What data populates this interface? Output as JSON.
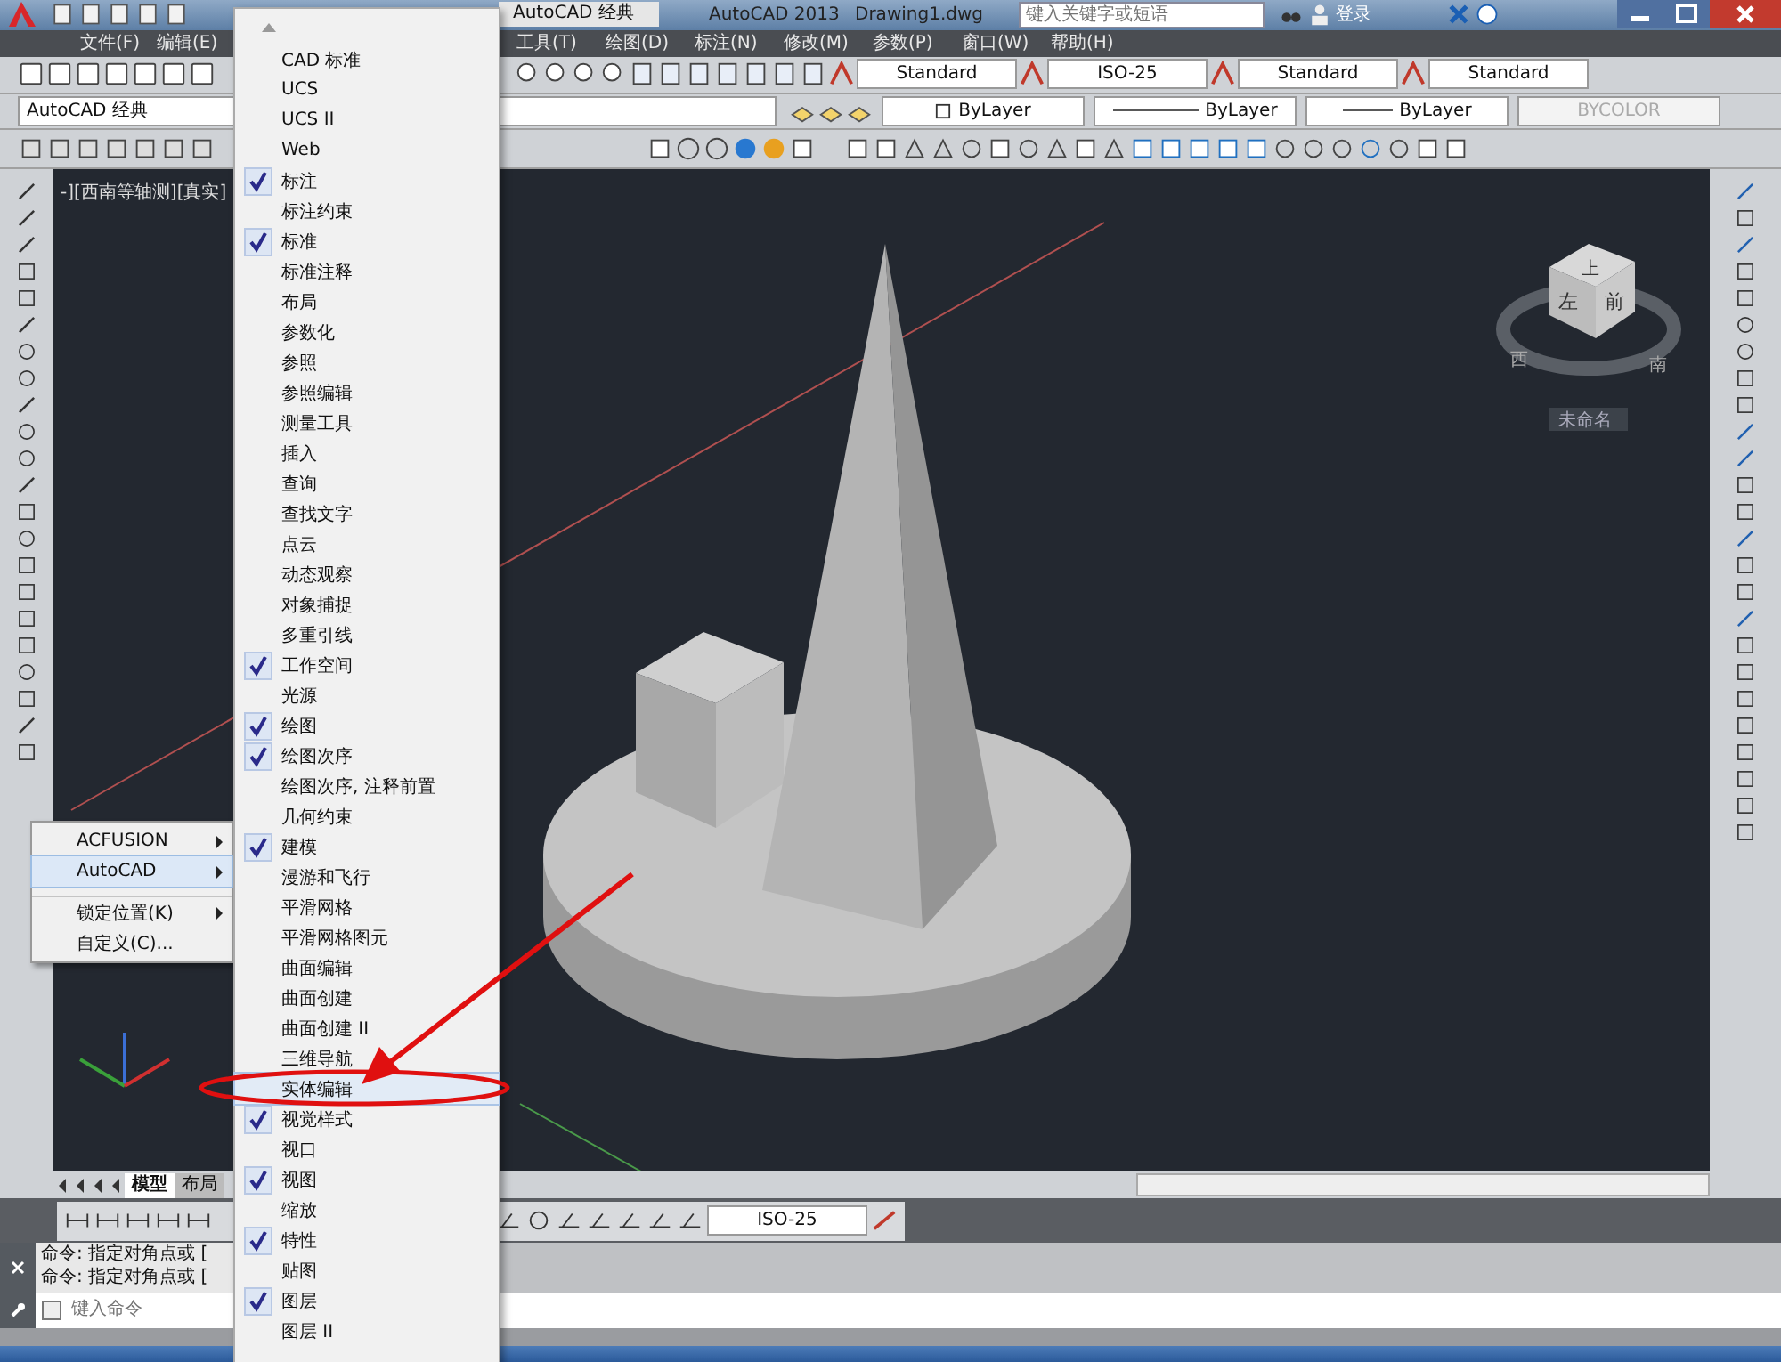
{
  "title_bar": {
    "workspace": "AutoCAD 经典",
    "app_title": "AutoCAD 2013",
    "file_name": "Drawing1.dwg",
    "search": {
      "placeholder": "键入关键字或短语"
    },
    "sign_in": "登录"
  },
  "menu_bar": [
    "文件(F)",
    "编辑(E)",
    "工具(T)",
    "绘图(D)",
    "标注(N)",
    "修改(M)",
    "参数(P)",
    "窗口(W)",
    "帮助(H)"
  ],
  "styles_toolbar": [
    "Standard",
    "ISO-25",
    "Standard",
    "Standard"
  ],
  "workspace_dropdown": "AutoCAD 经典",
  "properties_toolbar": [
    {
      "value": "ByLayer",
      "kind": "color",
      "disabled": false
    },
    {
      "value": "ByLayer",
      "kind": "linetype",
      "disabled": false
    },
    {
      "value": "ByLayer",
      "kind": "lineweight",
      "disabled": false
    },
    {
      "value": "BYCOLOR",
      "kind": "plain",
      "disabled": true
    }
  ],
  "viewport": {
    "label": "-][西南等轴测][真实]",
    "viewcube": {
      "top": "上",
      "left": "左",
      "front": "前",
      "west": "西",
      "south": "南",
      "label": "未命名"
    }
  },
  "layout_tabs": [
    {
      "label": "模型",
      "selected": true
    },
    {
      "label": "布局",
      "selected": false
    }
  ],
  "dim_style": "ISO-25",
  "command_history": [
    "命令: 指定对角点或 [",
    "命令: 指定对角点或 ["
  ],
  "command_input": {
    "placeholder": "键入命令"
  },
  "context_menu": [
    {
      "label": "ACFUSION",
      "submenu": true,
      "selected": false,
      "separator_before": false
    },
    {
      "label": "AutoCAD",
      "submenu": true,
      "selected": true,
      "separator_before": false
    },
    {
      "label": "锁定位置(K)",
      "submenu": true,
      "selected": false,
      "separator_before": true
    },
    {
      "label": "自定义(C)...",
      "submenu": false,
      "selected": false,
      "separator_before": false
    }
  ],
  "toolbar_menu": [
    {
      "label": "CAD 标准",
      "checked": false,
      "selected": false
    },
    {
      "label": "UCS",
      "checked": false,
      "selected": false
    },
    {
      "label": "UCS II",
      "checked": false,
      "selected": false
    },
    {
      "label": "Web",
      "checked": false,
      "selected": false
    },
    {
      "label": "标注",
      "checked": true,
      "selected": false
    },
    {
      "label": "标注约束",
      "checked": false,
      "selected": false
    },
    {
      "label": "标准",
      "checked": true,
      "selected": false
    },
    {
      "label": "标准注释",
      "checked": false,
      "selected": false
    },
    {
      "label": "布局",
      "checked": false,
      "selected": false
    },
    {
      "label": "参数化",
      "checked": false,
      "selected": false
    },
    {
      "label": "参照",
      "checked": false,
      "selected": false
    },
    {
      "label": "参照编辑",
      "checked": false,
      "selected": false
    },
    {
      "label": "测量工具",
      "checked": false,
      "selected": false
    },
    {
      "label": "插入",
      "checked": false,
      "selected": false
    },
    {
      "label": "查询",
      "checked": false,
      "selected": false
    },
    {
      "label": "查找文字",
      "checked": false,
      "selected": false
    },
    {
      "label": "点云",
      "checked": false,
      "selected": false
    },
    {
      "label": "动态观察",
      "checked": false,
      "selected": false
    },
    {
      "label": "对象捕捉",
      "checked": false,
      "selected": false
    },
    {
      "label": "多重引线",
      "checked": false,
      "selected": false
    },
    {
      "label": "工作空间",
      "checked": true,
      "selected": false
    },
    {
      "label": "光源",
      "checked": false,
      "selected": false
    },
    {
      "label": "绘图",
      "checked": true,
      "selected": false
    },
    {
      "label": "绘图次序",
      "checked": true,
      "selected": false
    },
    {
      "label": "绘图次序, 注释前置",
      "checked": false,
      "selected": false
    },
    {
      "label": "几何约束",
      "checked": false,
      "selected": false
    },
    {
      "label": "建模",
      "checked": true,
      "selected": false
    },
    {
      "label": "漫游和飞行",
      "checked": false,
      "selected": false
    },
    {
      "label": "平滑网格",
      "checked": false,
      "selected": false
    },
    {
      "label": "平滑网格图元",
      "checked": false,
      "selected": false
    },
    {
      "label": "曲面编辑",
      "checked": false,
      "selected": false
    },
    {
      "label": "曲面创建",
      "checked": false,
      "selected": false
    },
    {
      "label": "曲面创建 II",
      "checked": false,
      "selected": false
    },
    {
      "label": "三维导航",
      "checked": false,
      "selected": false
    },
    {
      "label": "实体编辑",
      "checked": false,
      "selected": true
    },
    {
      "label": "视觉样式",
      "checked": true,
      "selected": false
    },
    {
      "label": "视口",
      "checked": false,
      "selected": false
    },
    {
      "label": "视图",
      "checked": true,
      "selected": false
    },
    {
      "label": "缩放",
      "checked": false,
      "selected": false
    },
    {
      "label": "特性",
      "checked": true,
      "selected": false
    },
    {
      "label": "贴图",
      "checked": false,
      "selected": false
    },
    {
      "label": "图层",
      "checked": true,
      "selected": false
    },
    {
      "label": "图层 II",
      "checked": false,
      "selected": false
    }
  ]
}
